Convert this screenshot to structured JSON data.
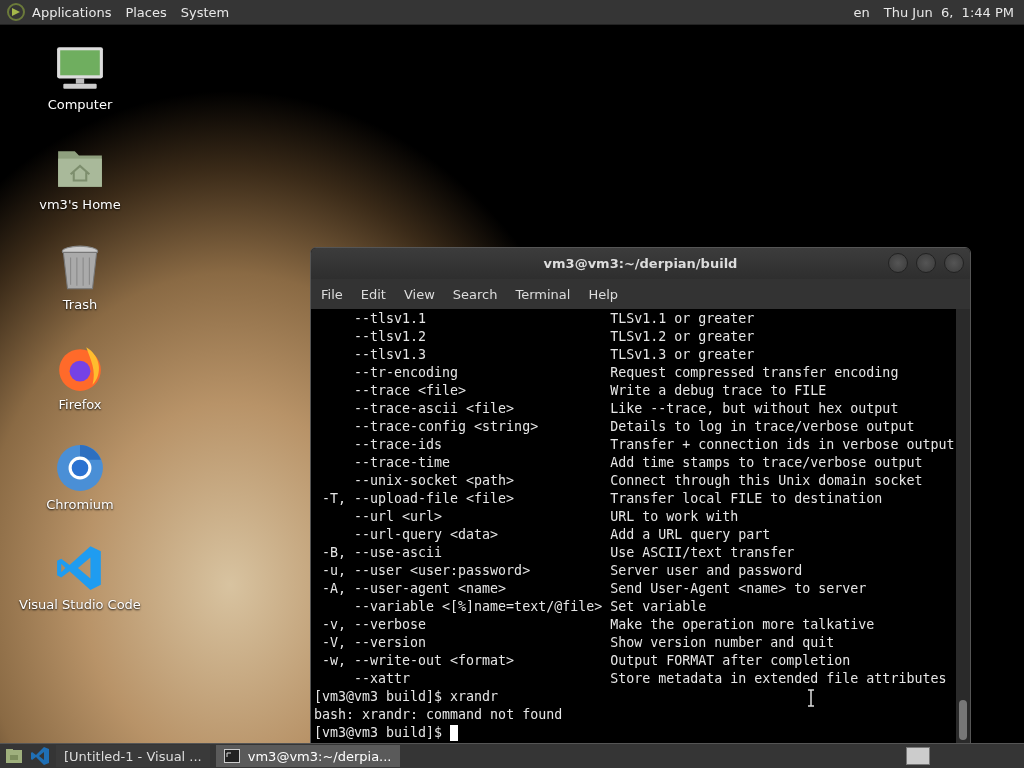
{
  "top_panel": {
    "menus": [
      "Applications",
      "Places",
      "System"
    ],
    "keyboard_layout": "en",
    "clock": "Thu Jun  6,  1:44 PM"
  },
  "desktop_icons": [
    {
      "kind": "computer",
      "label": "Computer"
    },
    {
      "kind": "home",
      "label": "vm3's Home"
    },
    {
      "kind": "trash",
      "label": "Trash"
    },
    {
      "kind": "firefox",
      "label": "Firefox"
    },
    {
      "kind": "chromium",
      "label": "Chromium"
    },
    {
      "kind": "vscode",
      "label": "Visual Studio Code"
    }
  ],
  "terminal": {
    "title": "vm3@vm3:~/derpian/build",
    "menu": [
      "File",
      "Edit",
      "View",
      "Search",
      "Terminal",
      "Help"
    ],
    "help_lines": [
      {
        "option": "--tlsv1.1",
        "description": "TLSv1.1 or greater"
      },
      {
        "option": "--tlsv1.2",
        "description": "TLSv1.2 or greater"
      },
      {
        "option": "--tlsv1.3",
        "description": "TLSv1.3 or greater"
      },
      {
        "option": "--tr-encoding",
        "description": "Request compressed transfer encoding"
      },
      {
        "option": "--trace <file>",
        "description": "Write a debug trace to FILE"
      },
      {
        "option": "--trace-ascii <file>",
        "description": "Like --trace, but without hex output"
      },
      {
        "option": "--trace-config <string>",
        "description": "Details to log in trace/verbose output"
      },
      {
        "option": "--trace-ids",
        "description": "Transfer + connection ids in verbose output"
      },
      {
        "option": "--trace-time",
        "description": "Add time stamps to trace/verbose output"
      },
      {
        "option": "--unix-socket <path>",
        "description": "Connect through this Unix domain socket"
      },
      {
        "short": "-T,",
        "option": "--upload-file <file>",
        "description": "Transfer local FILE to destination"
      },
      {
        "option": "--url <url>",
        "description": "URL to work with"
      },
      {
        "option": "--url-query <data>",
        "description": "Add a URL query part"
      },
      {
        "short": "-B,",
        "option": "--use-ascii",
        "description": "Use ASCII/text transfer"
      },
      {
        "short": "-u,",
        "option": "--user <user:password>",
        "description": "Server user and password"
      },
      {
        "short": "-A,",
        "option": "--user-agent <name>",
        "description": "Send User-Agent <name> to server"
      },
      {
        "option": "--variable <[%]name=text/@file>",
        "description": "Set variable"
      },
      {
        "short": "-v,",
        "option": "--verbose",
        "description": "Make the operation more talkative"
      },
      {
        "short": "-V,",
        "option": "--version",
        "description": "Show version number and quit"
      },
      {
        "short": "-w,",
        "option": "--write-out <format>",
        "description": "Output FORMAT after completion"
      },
      {
        "option": "--xattr",
        "description": "Store metadata in extended file attributes"
      }
    ],
    "session": [
      {
        "kind": "prompt",
        "prompt": "[vm3@vm3 build]$",
        "command": "xrandr"
      },
      {
        "kind": "output",
        "text": "bash: xrandr: command not found"
      },
      {
        "kind": "prompt",
        "prompt": "[vm3@vm3 build]$"
      }
    ]
  },
  "taskbar": {
    "tasks": [
      {
        "kind": "vscode",
        "label": "[Untitled-1 - Visual ...",
        "selected": false
      },
      {
        "kind": "terminal",
        "label": "vm3@vm3:~/derpia...",
        "selected": true
      }
    ]
  }
}
